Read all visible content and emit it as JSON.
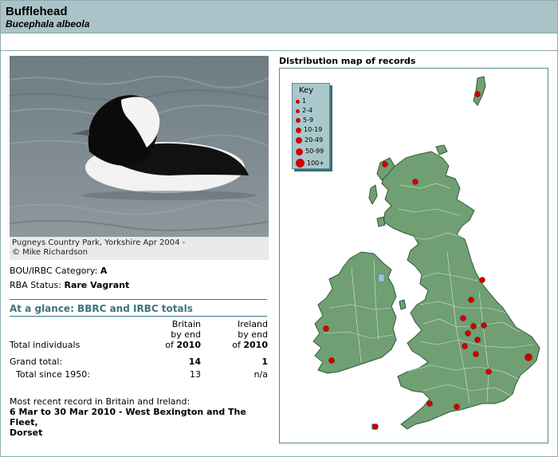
{
  "header": {
    "title": "Bufflehead",
    "latin": "Bucephala albeola"
  },
  "photo": {
    "caption_line1": "Pugneys Country Park, Yorkshire Apr 2004 -",
    "caption_line2": "© Mike Richardson"
  },
  "status": {
    "category_label": "BOU/IRBC Category:",
    "category_value": "A",
    "rba_label": "RBA Status:",
    "rba_value": "Rare Vagrant"
  },
  "glance": {
    "heading": "At a glance: BBRC and IRBC totals",
    "britain": {
      "name": "Britain",
      "line2": "by end",
      "line3": "of",
      "year": "2010"
    },
    "ireland": {
      "name": "Ireland",
      "line2": "by end",
      "line3": "of",
      "year": "2010"
    },
    "total_individuals_label": "Total individuals",
    "grand_total_label": "Grand total:",
    "grand_total_britain": "14",
    "grand_total_ireland": "1",
    "since_label": "Total since 1950:",
    "since_britain": "13",
    "since_ireland": "n/a"
  },
  "recent": {
    "label": "Most recent record in Britain and Ireland:",
    "line1": "6 Mar to 30 Mar 2010 - West Bexington and The Fleet,",
    "line2": "Dorset"
  },
  "map": {
    "title": "Distribution map of records",
    "key_title": "Key",
    "key_items": [
      "1",
      "2-4",
      "5-9",
      "10-19",
      "20-49",
      "50-99",
      "100+"
    ],
    "land_color": "#6f9f73",
    "record_color": "#d00000"
  }
}
